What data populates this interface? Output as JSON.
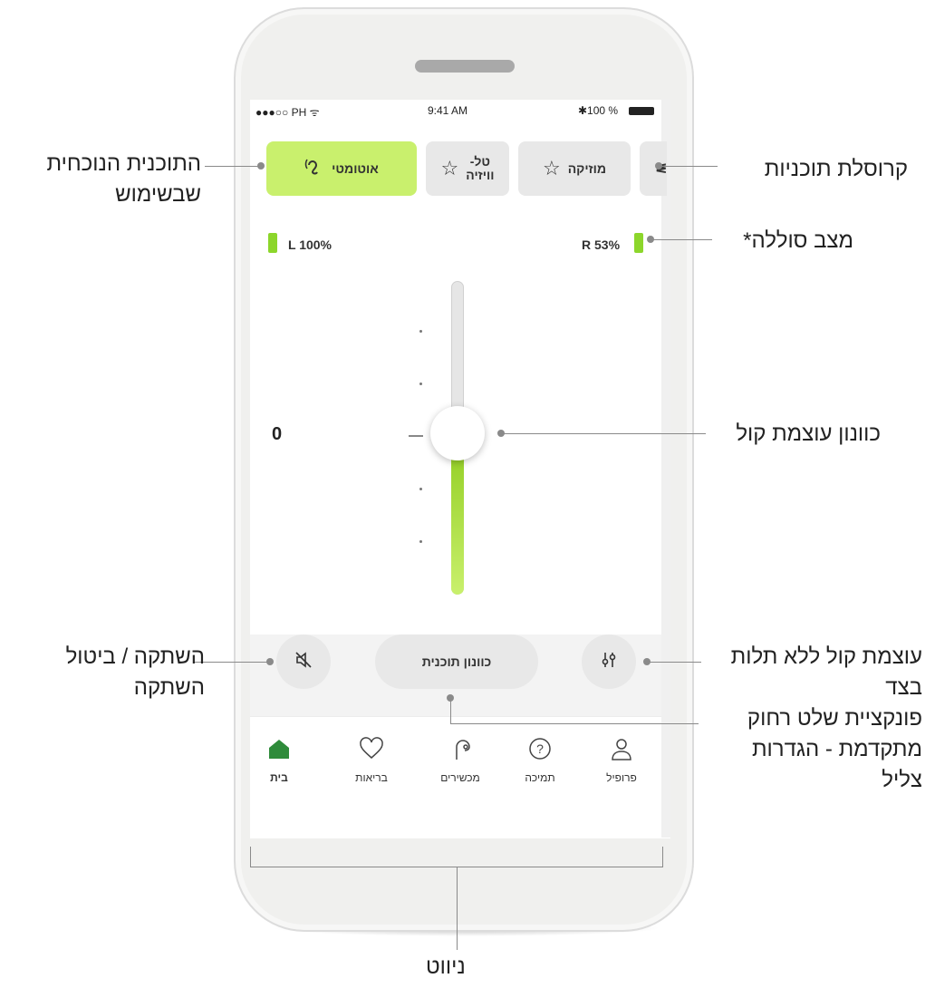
{
  "status_bar": {
    "carrier": "●●●○○ PH ᯤ",
    "time": "9:41 AM",
    "battery": "✱100 %"
  },
  "programs": [
    {
      "label": "אוטומטי",
      "icon": "ear-icon",
      "active": true
    },
    {
      "label_line1": "טל-",
      "label_line2": "וויזיה",
      "icon": "star-icon",
      "active": false
    },
    {
      "label": "מוזיקה",
      "icon": "star-icon",
      "active": false
    }
  ],
  "battery": {
    "left": "L 100%",
    "right": "R 53%",
    "color": "#8cd62b"
  },
  "volume": {
    "value": "0",
    "level_fraction": 0.5
  },
  "controls": {
    "mute_icon": "speaker-mute-icon",
    "tune_label": "כוונון תוכנית",
    "split_icon": "sliders-icon"
  },
  "nav": [
    {
      "label": "בית",
      "icon": "home-icon",
      "active": true
    },
    {
      "label": "בריאות",
      "icon": "heart-icon",
      "active": false
    },
    {
      "label": "מכשירים",
      "icon": "hearing-aid-icon",
      "active": false
    },
    {
      "label": "תמיכה",
      "icon": "help-icon",
      "active": false
    },
    {
      "label": "פרופיל",
      "icon": "person-icon",
      "active": false
    }
  ],
  "callouts": {
    "current_program_l1": "התוכנית הנוכחית",
    "current_program_l2": "שבשימוש",
    "carousel": "קרוסלת תוכניות",
    "battery": "מצב סוללה*",
    "volume": "כוונון עוצמת קול",
    "mute_l1": "השתקה / ביטול",
    "mute_l2": "השתקה",
    "split_l1": "עוצמת קול ללא תלות",
    "split_l2": "בצד",
    "remote_l1": "פונקציית שלט רחוק",
    "remote_l2": "מתקדמת - הגדרות",
    "remote_l3": "צליל",
    "navigation": "ניווט"
  },
  "colors": {
    "accent": "#c9f06d",
    "slider_fill": "#8fcc1f",
    "home_active": "#2e8b3a"
  }
}
